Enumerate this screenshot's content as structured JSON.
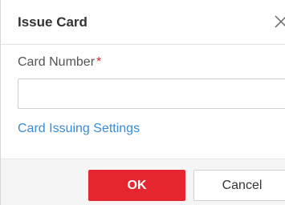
{
  "dialog": {
    "title": "Issue Card",
    "close_icon": "close-icon"
  },
  "form": {
    "card_number_label": "Card Number",
    "required_marker": "*",
    "card_number_value": "",
    "card_number_placeholder": ""
  },
  "links": {
    "card_issuing_settings": "Card Issuing Settings"
  },
  "footer": {
    "ok_label": "OK",
    "cancel_label": "Cancel"
  },
  "colors": {
    "primary": "#e5262f",
    "link": "#3a8ad6"
  }
}
